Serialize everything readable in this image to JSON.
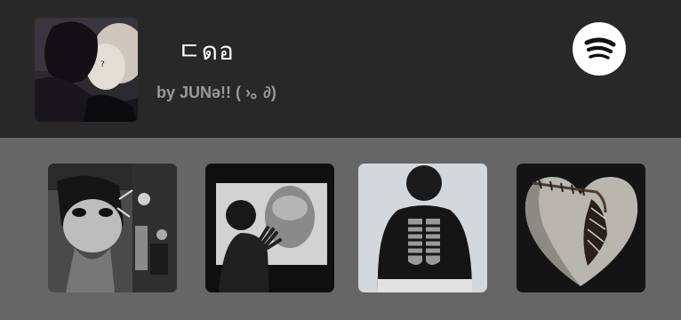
{
  "playlist": {
    "title": "ㄷดอ",
    "byline": "by JUNə!! ( ›｡ ∂)"
  },
  "icons": {
    "spotify": "spotify-logo-icon"
  },
  "colors": {
    "header_bg": "#282828",
    "page_bg": "#666666",
    "title": "#ffffff",
    "byline": "#9a9a9a"
  },
  "thumbnails": [
    {
      "name": "collage-face-artwork"
    },
    {
      "name": "silhouette-at-screen"
    },
    {
      "name": "ribcage-shirt-person"
    },
    {
      "name": "stitched-heart"
    }
  ]
}
